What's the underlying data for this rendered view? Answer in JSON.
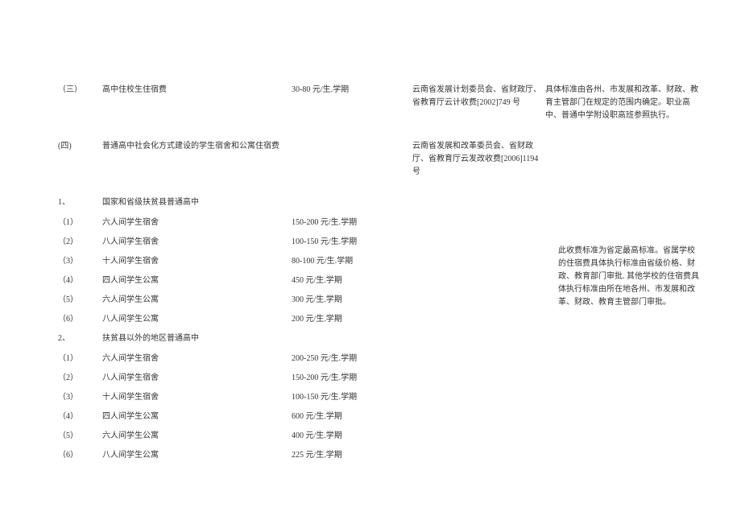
{
  "s3": {
    "idx": "（三）",
    "item": "高中住校生住宿费",
    "fee": "30-80 元/生.学期",
    "basis": "云南省发展计划委员会、省财政厅、省教育厅云计收费[2002]749 号",
    "note": "具体标准由各州、市发展和改革、财政、教育主管部门在规定的范围内确定。职业高中、普通中学附设职高班参照执行。"
  },
  "s4": {
    "idx": "(四)",
    "item": "普通高中社会化方式建设的学生宿舍和公寓住宿费",
    "basis": "云南省发展和改革委员会、省财政厅、省教育厅云发改收费[2006]1194 号"
  },
  "g1": {
    "idx": "1、",
    "label": "国家和省级扶贫县普通高中"
  },
  "g1r": [
    {
      "idx": "（1）",
      "item": "六人间学生宿舍",
      "fee": "150-200 元/生.学期"
    },
    {
      "idx": "（2）",
      "item": "八人间学生宿舍",
      "fee": "100-150 元/生.学期"
    },
    {
      "idx": "（3）",
      "item": "十人间学生宿舍",
      "fee": "80-100 元/生.学期"
    },
    {
      "idx": "（4）",
      "item": "四人间学生公寓",
      "fee": "450 元/生.学期"
    },
    {
      "idx": "（5）",
      "item": "六人间学生公寓",
      "fee": "300 元/生.学期"
    },
    {
      "idx": "（6）",
      "item": "八人间学生公寓",
      "fee": "200 元/生.学期"
    }
  ],
  "g2": {
    "idx": "2、",
    "label": "扶贫县以外的地区普通高中"
  },
  "g2r": [
    {
      "idx": "（1）",
      "item": "六人间学生宿舍",
      "fee": "200-250 元/生.学期"
    },
    {
      "idx": "（2）",
      "item": "八人间学生宿舍",
      "fee": "150-200 元/生.学期"
    },
    {
      "idx": "（3）",
      "item": "十人间学生宿舍",
      "fee": "100-150 元/生.学期"
    },
    {
      "idx": "（4）",
      "item": "四人间学生公寓",
      "fee": "600 元/生.学期"
    },
    {
      "idx": "（5）",
      "item": "六人间学生公寓",
      "fee": "400 元/生.学期"
    },
    {
      "idx": "（6）",
      "item": "八人间学生公寓",
      "fee": "225 元/生.学期"
    }
  ],
  "note4": "此收费标准为省定最高标准。省属学校的住宿费具体执行标准由省级价格、财政、教育部门审批. 其他学校的住宿费具体执行标准由所在地各州、市发展和改革、财政、教育主管部门审批。"
}
